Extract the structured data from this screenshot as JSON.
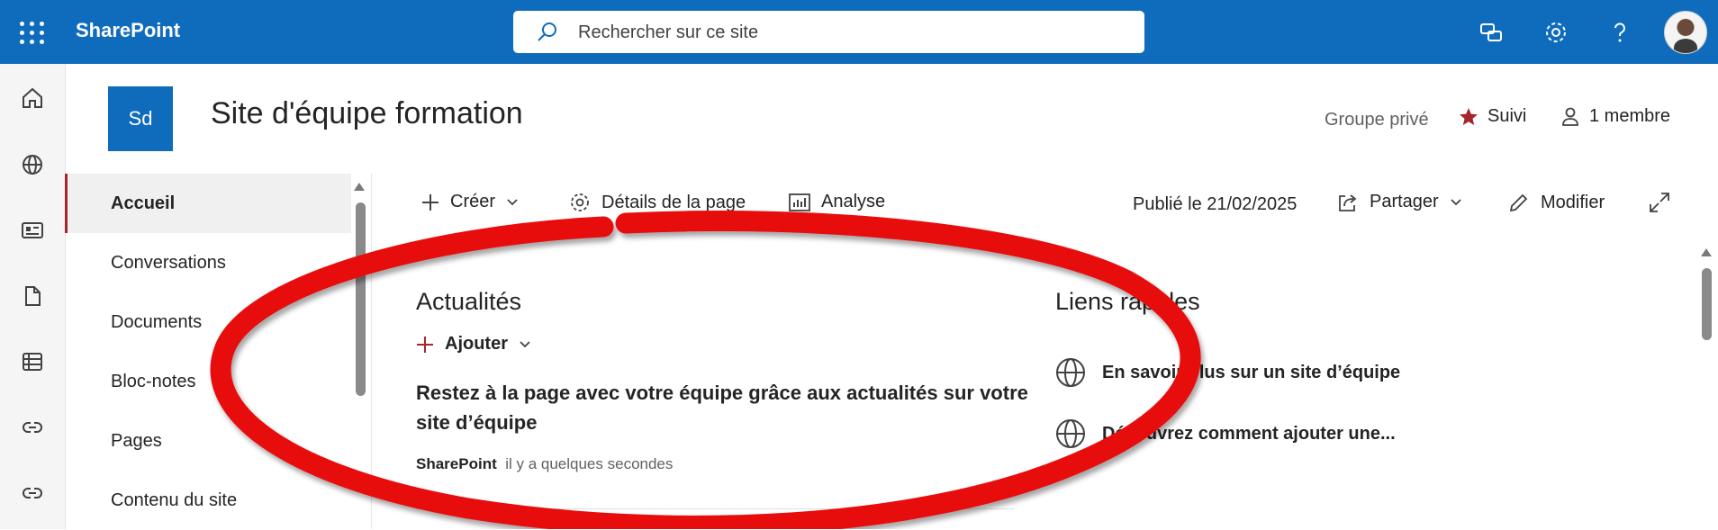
{
  "topbar": {
    "brand": "SharePoint",
    "search_placeholder": "Rechercher sur ce site",
    "icons": [
      "app-launcher-icon",
      "feedback-icon",
      "settings-icon",
      "help-icon",
      "avatar"
    ]
  },
  "site": {
    "logo_text": "Sd",
    "title": "Site d'équipe formation",
    "privacy": "Groupe privé",
    "follow_label": "Suivi",
    "members_label": "1 membre"
  },
  "nav": {
    "items": [
      {
        "label": "Accueil",
        "active": true
      },
      {
        "label": "Conversations"
      },
      {
        "label": "Documents"
      },
      {
        "label": "Bloc-notes"
      },
      {
        "label": "Pages"
      },
      {
        "label": "Contenu du site"
      }
    ]
  },
  "commandbar": {
    "create": "Créer",
    "page_details": "Détails de la page",
    "analytics": "Analyse",
    "published": "Publié le 21/02/2025",
    "share": "Partager",
    "edit": "Modifier"
  },
  "news": {
    "title": "Actualités",
    "add_label": "Ajouter",
    "headline": "Restez à la page avec votre équipe grâce aux actualités sur votre site d’équipe",
    "author": "SharePoint",
    "time": "il y a quelques secondes"
  },
  "quick_links": {
    "title": "Liens rapides",
    "items": [
      "En savoir plus sur un site d’équipe",
      "Découvrez comment ajouter une..."
    ]
  },
  "colors": {
    "brand_blue": "#0f6cbd",
    "annotation_red": "#e81010",
    "follow_star": "#a4262c"
  }
}
